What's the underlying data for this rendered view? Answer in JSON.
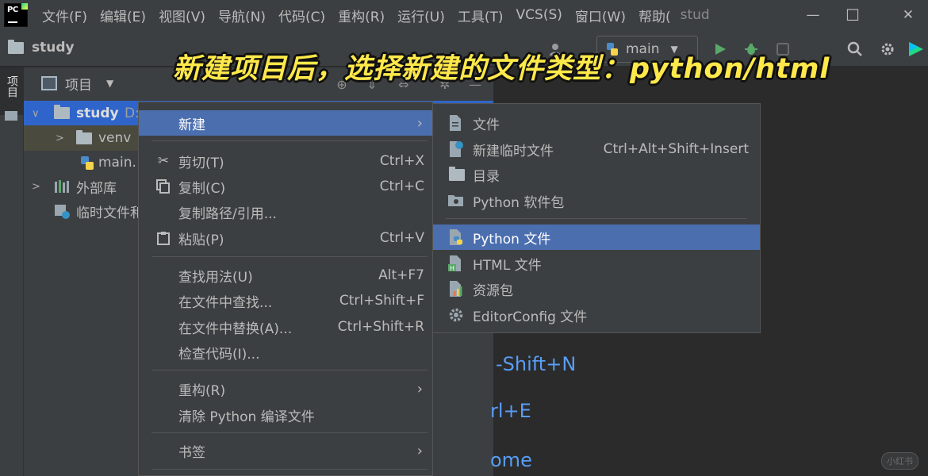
{
  "menubar": {
    "items": [
      "文件(F)",
      "编辑(E)",
      "视图(V)",
      "导航(N)",
      "代码(C)",
      "重构(R)",
      "运行(U)",
      "工具(T)",
      "VCS(S)",
      "窗口(W)",
      "帮助("
    ],
    "window_title": "stud"
  },
  "window_controls": {
    "minimize": "—",
    "maximize": "☐",
    "close": "✕"
  },
  "toolbar": {
    "breadcrumb": "study",
    "branch": "main"
  },
  "left_strip": {
    "tab_label": "项目"
  },
  "project_panel": {
    "title": "项目",
    "tree": [
      {
        "label": "study",
        "suffix": "D:"
      },
      {
        "label": "venv"
      },
      {
        "label": "main."
      },
      {
        "label": "外部库"
      },
      {
        "label": "临时文件和"
      }
    ]
  },
  "editor_hints": [
    "-Shift+N",
    "rl+E",
    "ome"
  ],
  "context_menu": {
    "items": [
      {
        "label": "新建",
        "shortcut": "",
        "submenu": true
      },
      {
        "label": "剪切(T)",
        "shortcut": "Ctrl+X",
        "icon": "scissors-icon"
      },
      {
        "label": "复制(C)",
        "shortcut": "Ctrl+C",
        "icon": "copy-icon"
      },
      {
        "label": "复制路径/引用...",
        "shortcut": ""
      },
      {
        "label": "粘贴(P)",
        "shortcut": "Ctrl+V",
        "icon": "paste-icon"
      },
      {
        "label": "查找用法(U)",
        "shortcut": "Alt+F7"
      },
      {
        "label": "在文件中查找...",
        "shortcut": "Ctrl+Shift+F"
      },
      {
        "label": "在文件中替换(A)...",
        "shortcut": "Ctrl+Shift+R"
      },
      {
        "label": "检查代码(I)...",
        "shortcut": ""
      },
      {
        "label": "重构(R)",
        "shortcut": "",
        "submenu": true
      },
      {
        "label": "清除 Python 编译文件",
        "shortcut": ""
      },
      {
        "label": "书签",
        "shortcut": "",
        "submenu": true
      }
    ]
  },
  "submenu": {
    "items": [
      {
        "label": "文件",
        "shortcut": "",
        "icon": "file-icon"
      },
      {
        "label": "新建临时文件",
        "shortcut": "Ctrl+Alt+Shift+Insert",
        "icon": "scratch-file-icon"
      },
      {
        "label": "目录",
        "shortcut": "",
        "icon": "folder-icon"
      },
      {
        "label": "Python 软件包",
        "shortcut": "",
        "icon": "package-icon"
      },
      {
        "label": "Python 文件",
        "shortcut": "",
        "icon": "python-file-icon"
      },
      {
        "label": "HTML 文件",
        "shortcut": "",
        "icon": "html-file-icon"
      },
      {
        "label": "资源包",
        "shortcut": "",
        "icon": "resource-bundle-icon"
      },
      {
        "label": "EditorConfig 文件",
        "shortcut": "",
        "icon": "gear-icon"
      }
    ]
  },
  "caption": "新建项目后，选择新建的文件类型：python/html",
  "watermark": "小红书",
  "colors": {
    "selection": "#4b6eaf",
    "tree_selection": "#2f65ca",
    "caption": "#ffe94a",
    "hint_blue": "#589df6"
  }
}
